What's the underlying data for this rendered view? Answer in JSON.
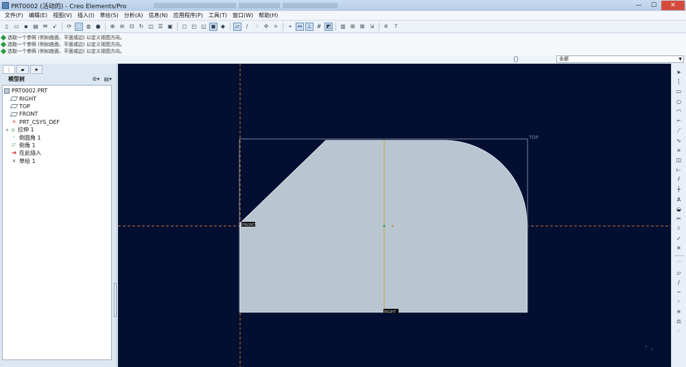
{
  "window": {
    "title": "PRT0002 (活动的) - Creo Elements/Pro",
    "controls": {
      "minimize": "—",
      "maximize": "☐",
      "close": "✕"
    }
  },
  "menu": [
    "文件(F)",
    "编辑(E)",
    "视图(V)",
    "插入(I)",
    "草绘(S)",
    "分析(A)",
    "信息(N)",
    "应用程序(P)",
    "工具(T)",
    "窗口(W)",
    "帮助(H)"
  ],
  "toolbar": {
    "help_label": "?"
  },
  "messages": [
    "选取一个参照 (例如曲面、平面或边) 以定义视图方向。",
    "选取一个参照 (例如曲面、平面或边) 以定义视图方向。",
    "选取一个参照 (例如曲面、平面或边) 以定义视图方向。"
  ],
  "filter": {
    "selected": "全部"
  },
  "model_tree": {
    "header": "模型树",
    "items": [
      {
        "label": "PRT0002.PRT",
        "icon": "part-icon"
      },
      {
        "label": "RIGHT",
        "icon": "datum-plane-icon"
      },
      {
        "label": "TOP",
        "icon": "datum-plane-icon"
      },
      {
        "label": "FRONT",
        "icon": "datum-plane-icon"
      },
      {
        "label": "PRT_CSYS_DEF",
        "icon": "csys-icon"
      },
      {
        "label": "拉伸 1",
        "icon": "extrude-icon"
      },
      {
        "label": "倒圆角 1",
        "icon": "round-icon"
      },
      {
        "label": "倒角 1",
        "icon": "chamfer-icon"
      },
      {
        "label": "在此插入",
        "icon": "insert-here-icon"
      },
      {
        "label": "草绘 1",
        "icon": "sketch-icon"
      }
    ]
  },
  "graphics": {
    "background": "#020f31",
    "plane_labels": {
      "top": "TOP",
      "front": "FRONT",
      "right": "RIGHT"
    },
    "colors": {
      "section_fill": "#b9c6d2",
      "reference_line": "#d8742c",
      "dim_line": "#c7a23b",
      "frame": "#7d8798"
    }
  }
}
